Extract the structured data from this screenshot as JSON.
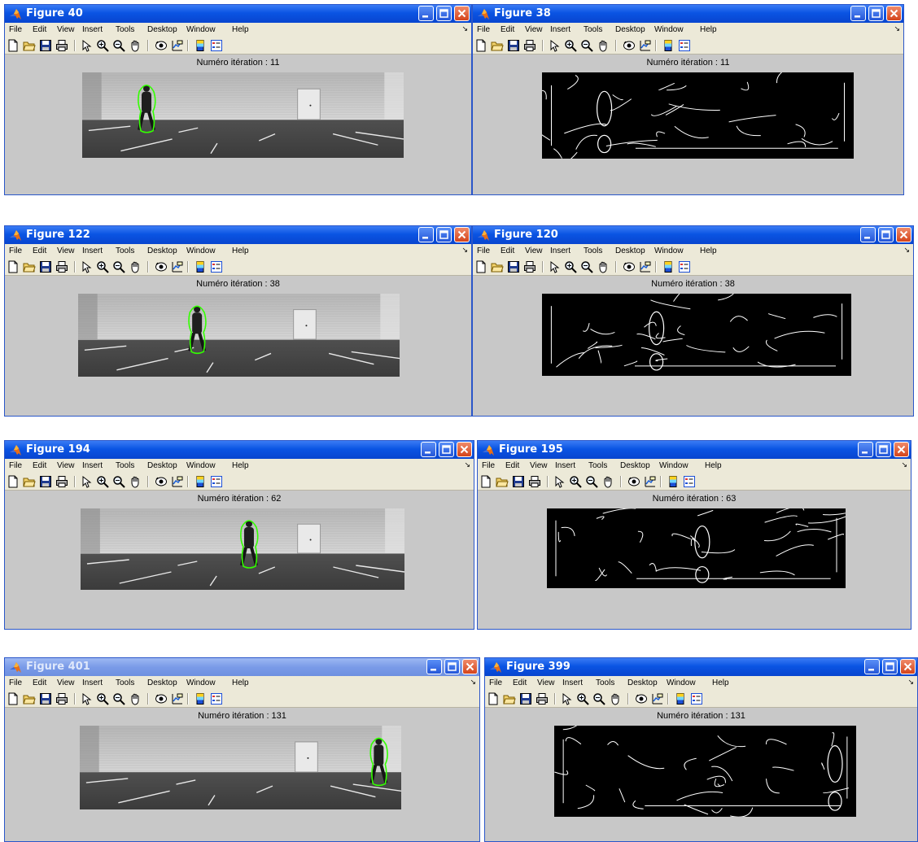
{
  "menu": [
    "File",
    "Edit",
    "View",
    "Insert",
    "Tools",
    "Desktop",
    "Window",
    "Help"
  ],
  "menu_arrow": "↘",
  "iteration_prefix": "Numéro itération :",
  "icons": [
    "new-file-icon",
    "open-folder-icon",
    "save-icon",
    "print-icon",
    "pointer-icon",
    "zoom-in-icon",
    "zoom-out-icon",
    "pan-hand-icon",
    "rotate-3d-icon",
    "data-cursor-icon",
    "colorbar-icon",
    "legend-icon",
    "hide-plot-tools-icon",
    "show-plot-tools-icon"
  ],
  "colors": {
    "title_active": "#0a54e3",
    "title_inactive": "#7a9be8",
    "contour": "#33ff00",
    "figure_bg": "#c8c8c8",
    "edge_bg": "#000000"
  },
  "rows": [
    {
      "left": {
        "title": "Figure 40",
        "iteration": "Numéro itération :  11",
        "active": true,
        "person_at": 0.2
      },
      "right": {
        "title": "Figure 38",
        "iteration": "Numéro itération :  11",
        "active": true,
        "person_at": 0.2
      }
    },
    {
      "left": {
        "title": "Figure 122",
        "iteration": "Numéro itération :  38",
        "active": true,
        "person_at": 0.37
      },
      "right": {
        "title": "Figure 120",
        "iteration": "Numéro itération :  38",
        "active": true,
        "person_at": 0.37
      }
    },
    {
      "left": {
        "title": "Figure 194",
        "iteration": "Numéro itération :  62",
        "active": true,
        "person_at": 0.52
      },
      "right": {
        "title": "Figure 195",
        "iteration": "Numéro itération :  63",
        "active": true,
        "person_at": 0.52
      }
    },
    {
      "left": {
        "title": "Figure 401",
        "iteration": "Numéro itération :  131",
        "active": false,
        "person_at": 0.93
      },
      "right": {
        "title": "Figure 399",
        "iteration": "Numéro itération :  131",
        "active": true,
        "person_at": 0.93
      }
    }
  ]
}
